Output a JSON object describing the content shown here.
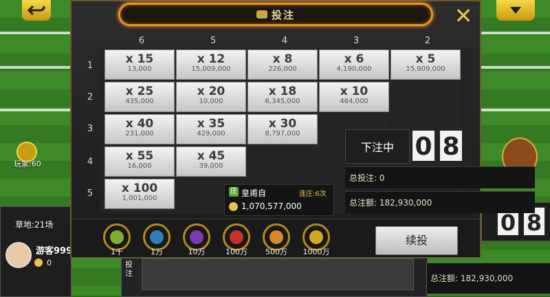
{
  "modal": {
    "title": "投注",
    "columns": [
      "6",
      "5",
      "4",
      "3",
      "2"
    ],
    "rows": [
      "1",
      "2",
      "3",
      "4",
      "5"
    ],
    "cells": [
      {
        "row": 1,
        "col": 0,
        "mult": "x 15",
        "amount": "13,000"
      },
      {
        "row": 1,
        "col": 1,
        "mult": "x 12",
        "amount": "15,009,000"
      },
      {
        "row": 1,
        "col": 2,
        "mult": "x 8",
        "amount": "226,000"
      },
      {
        "row": 1,
        "col": 3,
        "mult": "x 6",
        "amount": "4,190,000"
      },
      {
        "row": 1,
        "col": 4,
        "mult": "x 5",
        "amount": "15,909,000"
      },
      {
        "row": 2,
        "col": 0,
        "mult": "x 25",
        "amount": "435,000"
      },
      {
        "row": 2,
        "col": 1,
        "mult": "x 20",
        "amount": "10,000"
      },
      {
        "row": 2,
        "col": 2,
        "mult": "x 18",
        "amount": "6,345,000"
      },
      {
        "row": 2,
        "col": 3,
        "mult": "x 10",
        "amount": "464,000"
      },
      {
        "row": 3,
        "col": 0,
        "mult": "x 40",
        "amount": "231,000"
      },
      {
        "row": 3,
        "col": 1,
        "mult": "x 35",
        "amount": "429,000"
      },
      {
        "row": 3,
        "col": 2,
        "mult": "x 30",
        "amount": "8,797,000"
      },
      {
        "row": 4,
        "col": 0,
        "mult": "x 55",
        "amount": "16,000"
      },
      {
        "row": 4,
        "col": 1,
        "mult": "x 45",
        "amount": "39,000"
      },
      {
        "row": 5,
        "col": 0,
        "mult": "x 100",
        "amount": "1,001,000"
      }
    ],
    "status": "下注中",
    "countdown": [
      "0",
      "8"
    ],
    "total_bet_label": "总投注: 0",
    "total_amount_label": "总注额: 182,930,000",
    "banker": {
      "badge": "庄",
      "name": "皇甫自",
      "streak": "连庄:6次",
      "coins": "1,070,577,000"
    },
    "chips": [
      {
        "label": "1千",
        "color": "#7fae2a"
      },
      {
        "label": "1万",
        "color": "#2f7fb8"
      },
      {
        "label": "10万",
        "color": "#7a3bb0"
      },
      {
        "label": "100万",
        "color": "#c8322a"
      },
      {
        "label": "500万",
        "color": "#d8892a"
      },
      {
        "label": "1000万",
        "color": "#d0a824"
      }
    ],
    "repeat_label": "续投"
  },
  "background": {
    "players": "玩家:60",
    "venue": "草地:21场",
    "username": "游客999",
    "balance": "0",
    "bet_button": "投注",
    "bg_total_amount": "总注额: 182,930,000",
    "bg_countdown": [
      "0",
      "8"
    ],
    "bg_bet_label": "投注"
  }
}
